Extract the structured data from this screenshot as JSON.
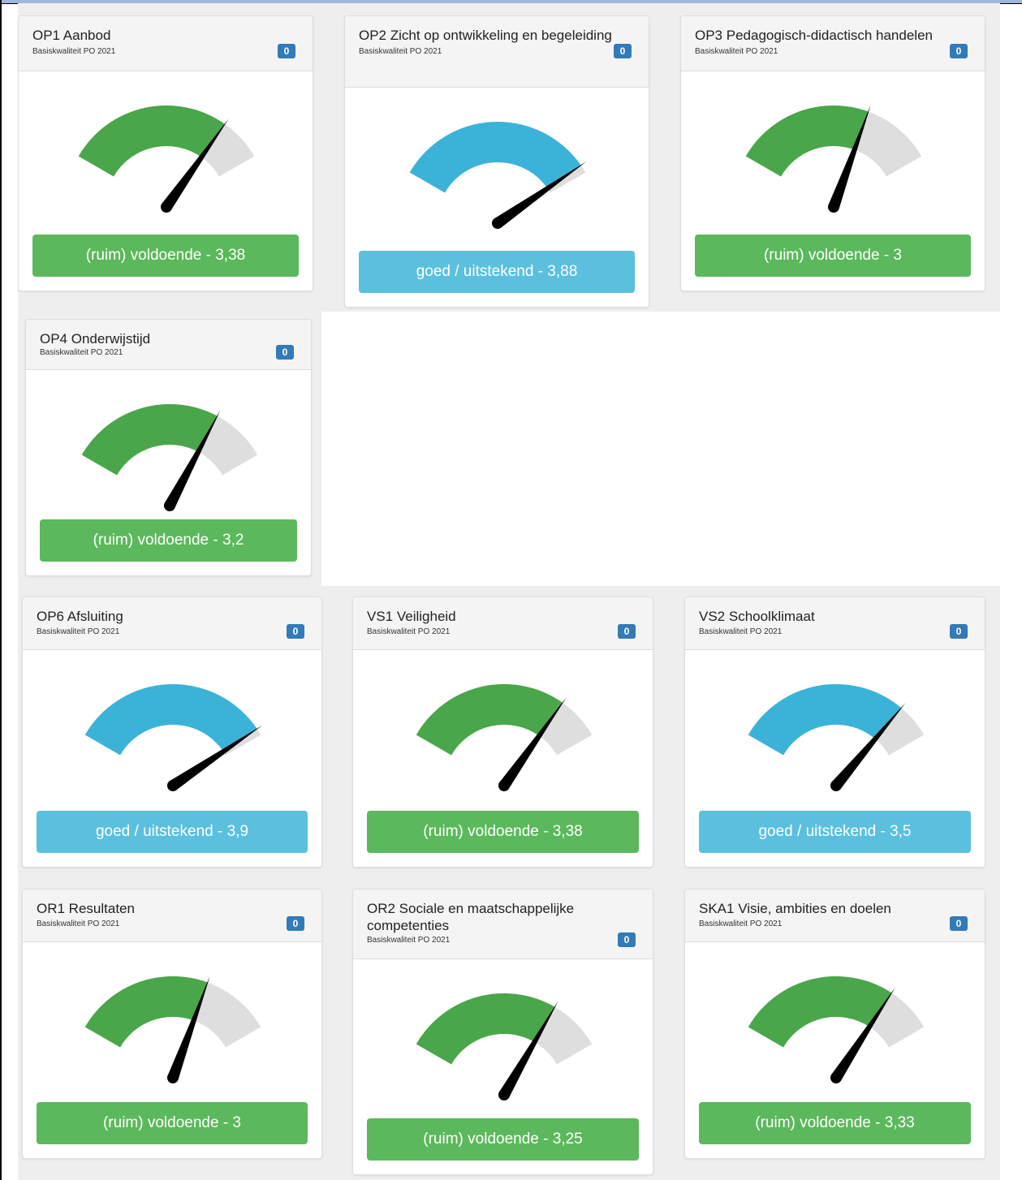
{
  "colors": {
    "green_arc": "#4aa64a",
    "blue_arc": "#3bb3d8",
    "track": "#dedede",
    "green_status": "#5cb85c",
    "blue_status": "#5bc0de",
    "badge": "#337ab7"
  },
  "gauge_scale": {
    "min": 1,
    "max": 4
  },
  "cards": [
    {
      "title": "OP1 Aanbod",
      "subtitle": "Basiskwaliteit PO 2021",
      "badge": "0",
      "status": "(ruim) voldoende - 3,38",
      "value": 3.38,
      "color": "green"
    },
    {
      "title": "OP2 Zicht op ontwikkeling en begeleiding",
      "subtitle": "Basiskwaliteit PO 2021",
      "badge": "0",
      "status": "goed / uitstekend - 3,88",
      "value": 3.88,
      "color": "blue"
    },
    {
      "title": "OP3 Pedagogisch-didactisch handelen",
      "subtitle": "Basiskwaliteit PO 2021",
      "badge": "0",
      "status": "(ruim) voldoende - 3",
      "value": 3.0,
      "color": "green"
    },
    {
      "title": "OP4 Onderwijstijd",
      "subtitle": "Basiskwaliteit PO 2021",
      "badge": "0",
      "status": "(ruim) voldoende - 3,2",
      "value": 3.2,
      "color": "green"
    },
    {
      "title": "OP6 Afsluiting",
      "subtitle": "Basiskwaliteit PO 2021",
      "badge": "0",
      "status": "goed / uitstekend - 3,9",
      "value": 3.9,
      "color": "blue"
    },
    {
      "title": "VS1 Veiligheid",
      "subtitle": "Basiskwaliteit PO 2021",
      "badge": "0",
      "status": "(ruim) voldoende - 3,38",
      "value": 3.38,
      "color": "green"
    },
    {
      "title": "VS2 Schoolklimaat",
      "subtitle": "Basiskwaliteit PO 2021",
      "badge": "0",
      "status": "goed / uitstekend - 3,5",
      "value": 3.5,
      "color": "blue"
    },
    {
      "title": "OR1 Resultaten",
      "subtitle": "Basiskwaliteit PO 2021",
      "badge": "0",
      "status": "(ruim) voldoende - 3",
      "value": 3.0,
      "color": "green"
    },
    {
      "title": "OR2 Sociale en maatschappelijke competenties",
      "subtitle": "Basiskwaliteit PO 2021",
      "badge": "0",
      "status": "(ruim) voldoende - 3,25",
      "value": 3.25,
      "color": "green"
    },
    {
      "title": "SKA1 Visie, ambities en doelen",
      "subtitle": "Basiskwaliteit PO 2021",
      "badge": "0",
      "status": "(ruim) voldoende - 3,33",
      "value": 3.33,
      "color": "green"
    }
  ]
}
